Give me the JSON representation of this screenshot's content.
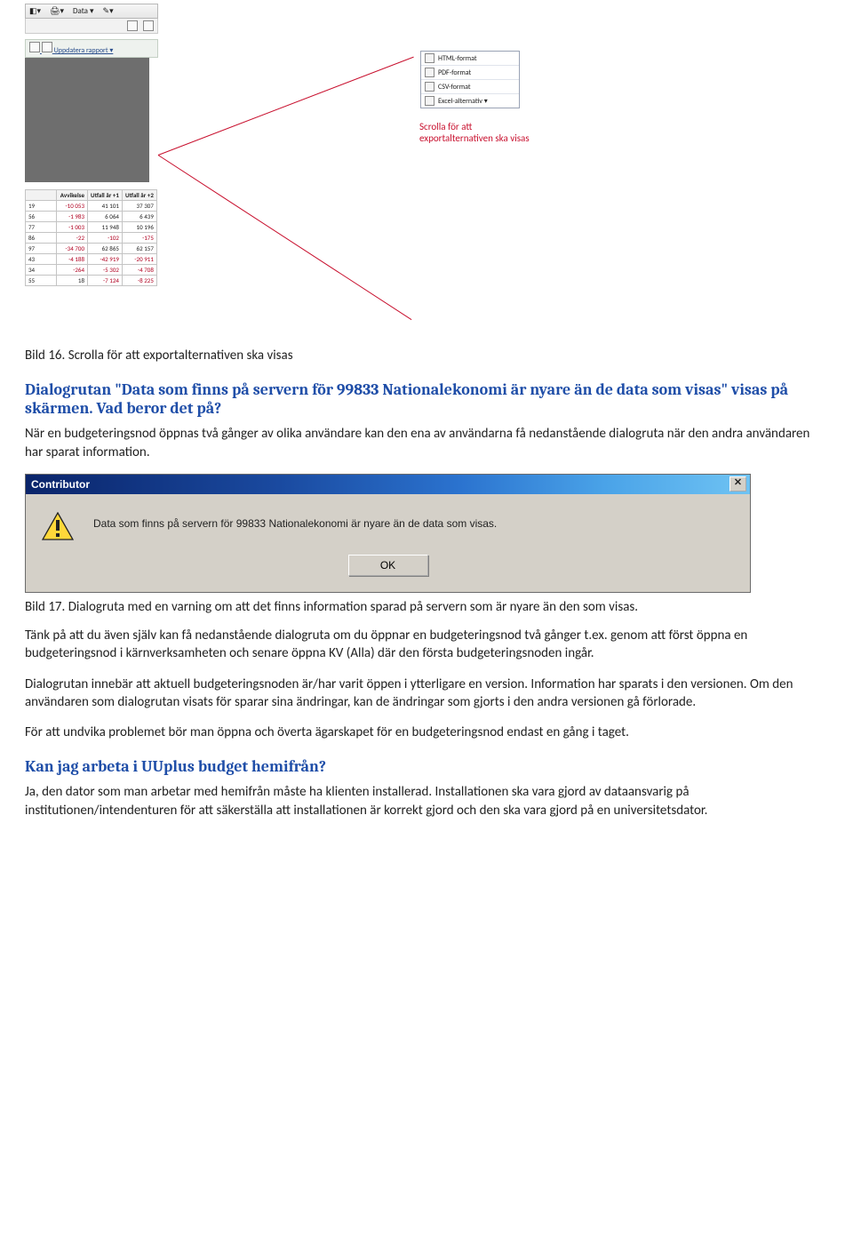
{
  "shot1": {
    "toolbar_data": "Data ▾",
    "link_text": "Uppdatera rapport ▾",
    "annotation": "Scrolla för att exportalternativen ska visas",
    "export_options": [
      "HTML-format",
      "PDF-format",
      "CSV-format",
      "Excel-alternativ ▾"
    ],
    "table": {
      "headers": [
        "",
        "Avvikelse",
        "Utfall år +1",
        "Utfall år +2"
      ],
      "rows": [
        [
          "19",
          "-10 053",
          "41 101",
          "37 307"
        ],
        [
          "56",
          "-1 983",
          "6 064",
          "6 439"
        ],
        [
          "77",
          "-1 003",
          "11 948",
          "10 196"
        ],
        [
          "86",
          "-22",
          "-102",
          "-175"
        ],
        [
          "97",
          "-34 700",
          "62 865",
          "62 157"
        ],
        [
          "43",
          "-4 188",
          "-42 919",
          "-20 911"
        ],
        [
          "34",
          "-264",
          "-5 302",
          "-4 708"
        ],
        [
          "55",
          "18",
          "-7 124",
          "-8 225"
        ]
      ]
    }
  },
  "caption1": "Bild 16. Scrolla för att exportalternativen ska visas",
  "q1_title": "Dialogrutan \"Data som finns på servern för 99833 Nationalekonomi är nyare än de data som visas\" visas på skärmen. Vad beror det på?",
  "q1_body": "När en budgeteringsnod öppnas två gånger av olika användare kan den ena av användarna få nedanstående dialogruta när den andra användaren har sparat information.",
  "dialog": {
    "title": "Contributor",
    "message": "Data som finns på servern för 99833 Nationalekonomi är nyare än de data som visas.",
    "ok": "OK"
  },
  "caption2": "Bild 17. Dialogruta med en varning om att det finns information sparad på servern som är nyare än den som visas.",
  "para1": "Tänk på att du även själv kan få nedanstående dialogruta om du öppnar en budgeteringsnod två gånger t.ex. genom att först öppna en budgeteringsnod i kärnverksamheten och senare öppna KV (Alla) där den första budgeteringsnoden ingår.",
  "para2": "Dialogrutan innebär att aktuell budgeteringsnoden är/har varit öppen i ytterligare en version. Information har sparats i den versionen. Om den användaren som dialogrutan visats för sparar sina ändringar, kan de ändringar som gjorts i den andra versionen gå förlorade.",
  "para3": "För att undvika problemet bör man öppna och överta ägarskapet för en budgeteringsnod endast en gång i taget.",
  "q2_title": "Kan jag arbeta i UUplus budget hemifrån?",
  "q2_body": "Ja, den dator som man arbetar med hemifrån måste ha klienten installerad. Installationen ska vara gjord av dataansvarig på institutionen/intendenturen för att säkerställa att installationen är korrekt gjord och den ska vara gjord på en universitetsdator."
}
